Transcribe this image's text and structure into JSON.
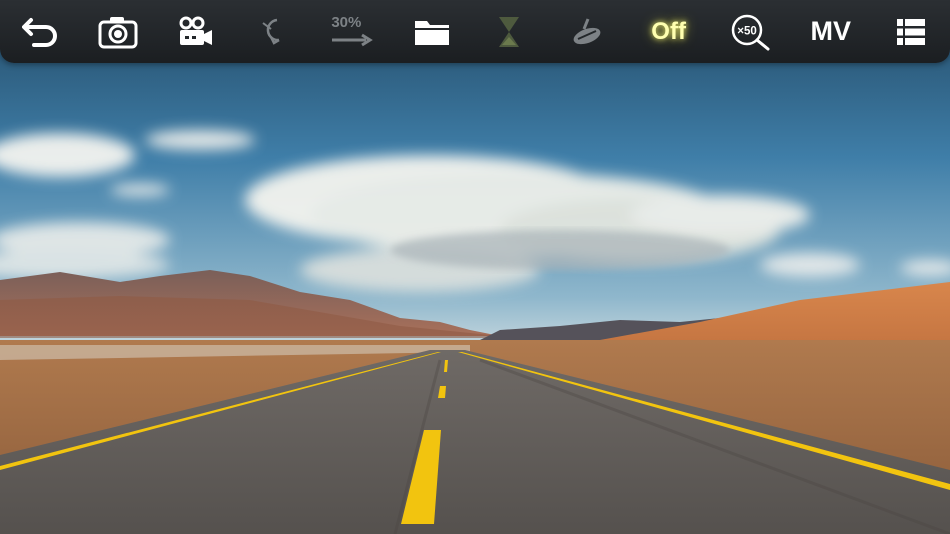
{
  "toolbar": {
    "back": {
      "icon": "back-arrow-icon"
    },
    "camera": {
      "icon": "camera-icon"
    },
    "video": {
      "icon": "video-camera-icon"
    },
    "rotate": {
      "icon": "rotate-icon",
      "state": "disabled"
    },
    "speed": {
      "icon": "speed-arrow-icon",
      "label": "30%",
      "state": "disabled"
    },
    "folder": {
      "icon": "folder-icon"
    },
    "timer": {
      "icon": "hourglass-icon",
      "state": "disabled"
    },
    "gimbal": {
      "icon": "gimbal-icon",
      "state": "disabled"
    },
    "power": {
      "label": "Off",
      "color": "#ffffb0"
    },
    "zoom": {
      "icon": "zoom-magnifier-icon",
      "label": "×50"
    },
    "mode": {
      "label": "MV"
    },
    "menu": {
      "icon": "list-menu-icon"
    }
  },
  "colors": {
    "toolbar_bg": "#23272a",
    "icon_active": "#ffffff",
    "icon_disabled": "#7d8286",
    "road_line": "#f2c40f"
  }
}
